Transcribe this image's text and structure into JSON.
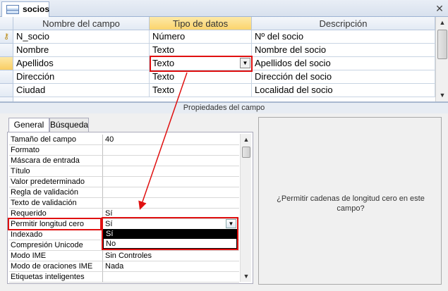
{
  "window": {
    "tab_title": "socios",
    "close_glyph": "✕"
  },
  "grid": {
    "headers": [
      "Nombre del campo",
      "Tipo de datos",
      "Descripción"
    ],
    "rows": [
      {
        "name": "N_socio",
        "type": "Número",
        "desc": "Nº del socio"
      },
      {
        "name": "Nombre",
        "type": "Texto",
        "desc": "Nombre del socio"
      },
      {
        "name": "Apellidos",
        "type": "Texto",
        "desc": "Apellidos del socio"
      },
      {
        "name": "Dirección",
        "type": "Texto",
        "desc": "Dirección del socio"
      },
      {
        "name": "Ciudad",
        "type": "Texto",
        "desc": "Localidad del socio"
      }
    ]
  },
  "properties": {
    "title": "Propiedades del campo",
    "tabs": [
      "General",
      "Búsqueda"
    ],
    "rows": [
      {
        "name": "Tamaño del campo",
        "value": "40"
      },
      {
        "name": "Formato",
        "value": ""
      },
      {
        "name": "Máscara de entrada",
        "value": ""
      },
      {
        "name": "Título",
        "value": ""
      },
      {
        "name": "Valor predeterminado",
        "value": ""
      },
      {
        "name": "Regla de validación",
        "value": ""
      },
      {
        "name": "Texto de validación",
        "value": ""
      },
      {
        "name": "Requerido",
        "value": "Sí"
      },
      {
        "name": "Permitir longitud cero",
        "value": "Sí"
      },
      {
        "name": "Indexado",
        "value": ""
      },
      {
        "name": "Compresión Unicode",
        "value": ""
      },
      {
        "name": "Modo IME",
        "value": "Sin Controles"
      },
      {
        "name": "Modo de oraciones IME",
        "value": "Nada"
      },
      {
        "name": "Etiquetas inteligentes",
        "value": ""
      }
    ],
    "dropdown_options": [
      "Sí",
      "No"
    ],
    "help_text": "¿Permitir cadenas de longitud cero en este campo?"
  },
  "colors": {
    "highlight": "#e01010",
    "selected_header": "#fbd46c"
  }
}
